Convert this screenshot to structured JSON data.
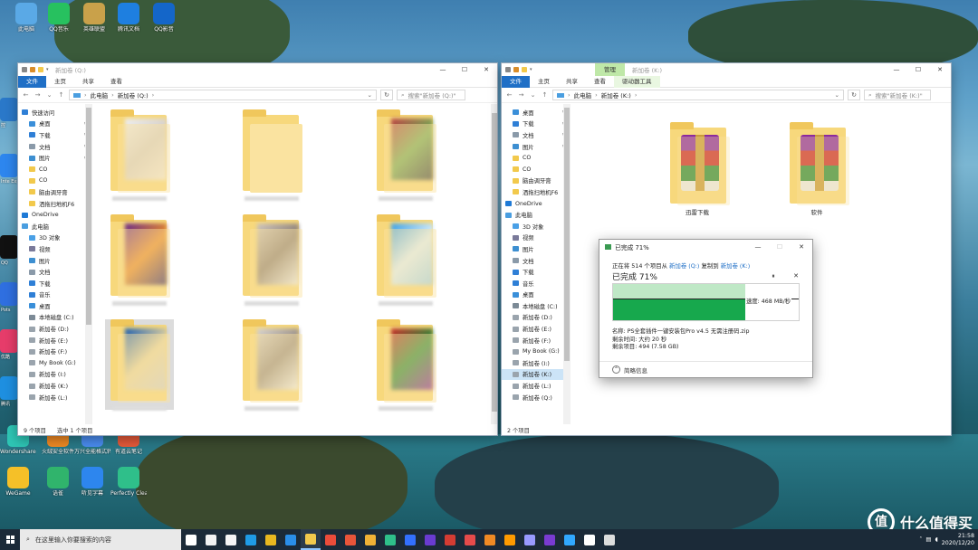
{
  "desktop": {
    "top_icons": [
      {
        "label": "此电脑",
        "color": "#5aa9e6"
      },
      {
        "label": "QQ音乐",
        "color": "#27c15f"
      },
      {
        "label": "英雄联盟",
        "color": "#c9a14a"
      },
      {
        "label": "腾讯文档",
        "color": "#1e7fe0"
      },
      {
        "label": "QQ影音",
        "color": "#1466c9"
      }
    ],
    "bottom_icons": [
      {
        "label": "Wondershare Filmora9",
        "color": "#2ec6b5"
      },
      {
        "label": "火绒安全软件",
        "color": "#f08a24"
      },
      {
        "label": "万兴全能格式转换器",
        "color": "#4a8cf0"
      },
      {
        "label": "有道云笔记",
        "color": "#e65a3a"
      },
      {
        "label": "WeGame",
        "color": "#f5c028"
      },
      {
        "label": "语雀",
        "color": "#30b46c"
      },
      {
        "label": "听见字幕",
        "color": "#2d86ee"
      },
      {
        "label": "Perfectly Clear V3",
        "color": "#2fbf8a"
      }
    ],
    "side_labels": [
      "控",
      "Inte Expl",
      "QQ",
      "Pots",
      "优酷",
      "腾讯"
    ]
  },
  "window_q": {
    "tabs": [
      "文件",
      "主页",
      "共享",
      "查看"
    ],
    "breadcrumb": [
      "此电脑",
      "新加卷 (Q:)"
    ],
    "title": "新加卷 (Q:)",
    "search_placeholder": "搜索\"新加卷 (Q:)\"",
    "nav": [
      {
        "label": "快速访问",
        "icon": "star-icon",
        "color": "#2f7fd6",
        "pinned": false
      },
      {
        "label": "桌面",
        "icon": "desktop-icon",
        "color": "#3a8fd9",
        "pinned": true
      },
      {
        "label": "下载",
        "icon": "download-icon",
        "color": "#2f7fd6",
        "pinned": true
      },
      {
        "label": "文档",
        "icon": "document-icon",
        "color": "#8a9aa9",
        "pinned": true
      },
      {
        "label": "图片",
        "icon": "picture-icon",
        "color": "#3d8fd1",
        "pinned": true
      },
      {
        "label": "CO",
        "icon": "folder-icon",
        "color": "#f2c94c",
        "pinned": false
      },
      {
        "label": "CO",
        "icon": "folder-icon",
        "color": "#f2c94c",
        "pinned": false
      },
      {
        "label": "脑由调牙膏",
        "icon": "folder-icon",
        "color": "#f2c94c",
        "pinned": false
      },
      {
        "label": "洒拖扫地机F6",
        "icon": "folder-icon",
        "color": "#f2c94c",
        "pinned": false
      },
      {
        "label": "OneDrive",
        "icon": "cloud-icon",
        "color": "#1f7ad6",
        "pinned": false
      },
      {
        "label": "此电脑",
        "icon": "computer-icon",
        "color": "#4a9ee0",
        "pinned": false
      },
      {
        "label": "3D 对象",
        "icon": "cube-icon",
        "color": "#4aa0e6",
        "pinned": false
      },
      {
        "label": "视频",
        "icon": "video-icon",
        "color": "#7a7a9a",
        "pinned": false
      },
      {
        "label": "图片",
        "icon": "picture-icon",
        "color": "#3d8fd1",
        "pinned": false
      },
      {
        "label": "文档",
        "icon": "document-icon",
        "color": "#8a9aa9",
        "pinned": false
      },
      {
        "label": "下载",
        "icon": "download-icon",
        "color": "#2f7fd6",
        "pinned": false
      },
      {
        "label": "音乐",
        "icon": "music-icon",
        "color": "#2f7fd6",
        "pinned": false
      },
      {
        "label": "桌面",
        "icon": "desktop-icon",
        "color": "#3a8fd9",
        "pinned": false
      },
      {
        "label": "本地磁盘 (C:)",
        "icon": "drive-icon",
        "color": "#7c8a96",
        "pinned": false
      },
      {
        "label": "新加卷 (D:)",
        "icon": "drive-icon",
        "color": "#9aa4ad",
        "pinned": false
      },
      {
        "label": "新加卷 (E:)",
        "icon": "drive-icon",
        "color": "#9aa4ad",
        "pinned": false
      },
      {
        "label": "新加卷 (F:)",
        "icon": "drive-icon",
        "color": "#9aa4ad",
        "pinned": false
      },
      {
        "label": "My Book (G:)",
        "icon": "drive-icon",
        "color": "#9aa4ad",
        "pinned": false
      },
      {
        "label": "新加卷 (I:)",
        "icon": "drive-icon",
        "color": "#9aa4ad",
        "pinned": false
      },
      {
        "label": "新加卷 (K:)",
        "icon": "drive-icon",
        "color": "#9aa4ad",
        "pinned": false
      },
      {
        "label": "新加卷 (L:)",
        "icon": "drive-icon",
        "color": "#9aa4ad",
        "pinned": false
      }
    ],
    "status_count": "9 个项目",
    "status_selected": "选中 1 个项目"
  },
  "window_k": {
    "tool_tab": "管理",
    "tabs": [
      "文件",
      "主页",
      "共享",
      "查看",
      "驱动器工具"
    ],
    "breadcrumb": [
      "此电脑",
      "新加卷 (K:)"
    ],
    "title": "新加卷 (K:)",
    "search_placeholder": "搜索\"新加卷 (K:)\"",
    "nav": [
      {
        "label": "桌面",
        "icon": "desktop-icon",
        "color": "#3a8fd9",
        "pinned": true
      },
      {
        "label": "下载",
        "icon": "download-icon",
        "color": "#2f7fd6",
        "pinned": true
      },
      {
        "label": "文档",
        "icon": "document-icon",
        "color": "#8a9aa9",
        "pinned": true
      },
      {
        "label": "图片",
        "icon": "picture-icon",
        "color": "#3d8fd1",
        "pinned": true
      },
      {
        "label": "CO",
        "icon": "folder-icon",
        "color": "#f2c94c",
        "pinned": false
      },
      {
        "label": "CO",
        "icon": "folder-icon",
        "color": "#f2c94c",
        "pinned": false
      },
      {
        "label": "脑由调牙膏",
        "icon": "folder-icon",
        "color": "#f2c94c",
        "pinned": false
      },
      {
        "label": "洒拖扫地机F6",
        "icon": "folder-icon",
        "color": "#f2c94c",
        "pinned": false
      },
      {
        "label": "OneDrive",
        "icon": "cloud-icon",
        "color": "#1f7ad6",
        "pinned": false
      },
      {
        "label": "此电脑",
        "icon": "computer-icon",
        "color": "#4a9ee0",
        "pinned": false
      },
      {
        "label": "3D 对象",
        "icon": "cube-icon",
        "color": "#4aa0e6",
        "pinned": false
      },
      {
        "label": "视频",
        "icon": "video-icon",
        "color": "#7a7a9a",
        "pinned": false
      },
      {
        "label": "图片",
        "icon": "picture-icon",
        "color": "#3d8fd1",
        "pinned": false
      },
      {
        "label": "文档",
        "icon": "document-icon",
        "color": "#8a9aa9",
        "pinned": false
      },
      {
        "label": "下载",
        "icon": "download-icon",
        "color": "#2f7fd6",
        "pinned": false
      },
      {
        "label": "音乐",
        "icon": "music-icon",
        "color": "#2f7fd6",
        "pinned": false
      },
      {
        "label": "桌面",
        "icon": "desktop-icon",
        "color": "#3a8fd9",
        "pinned": false
      },
      {
        "label": "本地磁盘 (C:)",
        "icon": "drive-icon",
        "color": "#7c8a96",
        "pinned": false
      },
      {
        "label": "新加卷 (D:)",
        "icon": "drive-icon",
        "color": "#9aa4ad",
        "pinned": false
      },
      {
        "label": "新加卷 (E:)",
        "icon": "drive-icon",
        "color": "#9aa4ad",
        "pinned": false
      },
      {
        "label": "新加卷 (F:)",
        "icon": "drive-icon",
        "color": "#9aa4ad",
        "pinned": false
      },
      {
        "label": "My Book (G:)",
        "icon": "drive-icon",
        "color": "#9aa4ad",
        "pinned": false
      },
      {
        "label": "新加卷 (I:)",
        "icon": "drive-icon",
        "color": "#9aa4ad",
        "pinned": false
      },
      {
        "label": "新加卷 (K:)",
        "icon": "drive-icon",
        "color": "#9aa4ad",
        "pinned": false,
        "selected": true
      },
      {
        "label": "新加卷 (L:)",
        "icon": "drive-icon",
        "color": "#9aa4ad",
        "pinned": false
      },
      {
        "label": "新加卷 (Q:)",
        "icon": "drive-icon",
        "color": "#9aa4ad",
        "pinned": false
      }
    ],
    "folders": [
      {
        "label": "迅雷下载"
      },
      {
        "label": "软件"
      }
    ],
    "status_count": "2 个项目"
  },
  "copy_dialog": {
    "title": "已完成 71%",
    "line_prefix": "正在将 514 个项目从",
    "source": "新加卷 (Q:)",
    "line_mid": "复制到",
    "dest": "新加卷 (K:)",
    "percent_text": "已完成 71%",
    "progress": 0.71,
    "speed": "速度: 468 MB/秒",
    "name": "名称: PS全套插件一键安装包Pro v4.5 无需注册码.zip",
    "time_left": "剩余时间: 大约 20 秒",
    "items_left": "剩余项目: 494 (7.58 GB)",
    "details_toggle": "简略信息"
  },
  "taskbar": {
    "search_placeholder": "在这里输入你要搜索的内容",
    "apps": [
      {
        "icon": "task-view-icon",
        "color": "#ffffff"
      },
      {
        "icon": "taskbar-app-1-icon",
        "color": "#f2f2f2"
      },
      {
        "icon": "store-icon",
        "color": "#f5f5f5"
      },
      {
        "icon": "edge-icon",
        "color": "#1f9be6"
      },
      {
        "icon": "chrome-icon",
        "color": "#e9b820"
      },
      {
        "icon": "player-icon",
        "color": "#2a8ee8"
      },
      {
        "icon": "file-explorer-icon",
        "color": "#f2c94c"
      },
      {
        "icon": "xmind-icon",
        "color": "#ea4c3a"
      },
      {
        "icon": "wps-icon",
        "color": "#e8553a"
      },
      {
        "icon": "g-app-icon",
        "color": "#f0b236"
      },
      {
        "icon": "app-green-icon",
        "color": "#2fbf8a"
      },
      {
        "icon": "feishu-icon",
        "color": "#3370ff"
      },
      {
        "icon": "photos-icon",
        "color": "#6a3bd1"
      },
      {
        "icon": "wangyi-music-icon",
        "color": "#d43c33"
      },
      {
        "icon": "app-red-icon",
        "color": "#e64b4b"
      },
      {
        "icon": "app-orange-icon",
        "color": "#f08a24"
      },
      {
        "icon": "illustrator-icon",
        "color": "#ff9a00"
      },
      {
        "icon": "premiere-icon",
        "color": "#9999ff"
      },
      {
        "icon": "app-purple-icon",
        "color": "#7a3bd1"
      },
      {
        "icon": "photoshop-icon",
        "color": "#31a8ff"
      },
      {
        "icon": "app-white-icon",
        "color": "#ffffff"
      },
      {
        "icon": "alien-icon",
        "color": "#dddddd"
      }
    ],
    "date": "2020/12/20",
    "time": "21:58"
  },
  "watermark": {
    "logo": "值",
    "text": "什么值得买"
  }
}
